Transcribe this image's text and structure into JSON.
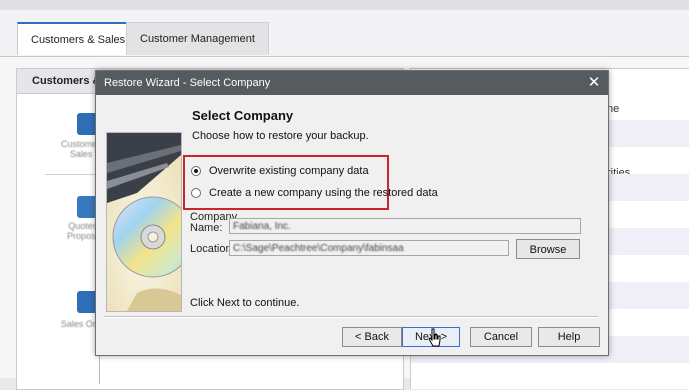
{
  "app": {
    "tabs": [
      {
        "label": "Customers & Sales"
      },
      {
        "label": "Customer Management"
      }
    ],
    "left_panel_title": "Customers & S",
    "workflow_labels": [
      "Customers & Sales Ta",
      "Quotes & Proposals",
      "Sales Orders"
    ],
    "right_panel_texts": [
      "ne",
      "rities"
    ]
  },
  "dialog": {
    "title": "Restore Wizard - Select Company",
    "close_label": "✕",
    "heading": "Select Company",
    "subheading": "Choose how to restore your backup.",
    "options": [
      {
        "label": "Overwrite existing company data",
        "selected": true
      },
      {
        "label": "Create a new company using the restored data",
        "selected": false
      }
    ],
    "company_name_label_line1": "Company",
    "company_name_label_line2": "Name:",
    "company_name_value": "Fabiana, Inc.",
    "location_label": "Location:",
    "location_value": "C:\\Sage\\Peachtree\\Company\\fabinsaa",
    "browse_label": "Browse",
    "hint": "Click Next to continue.",
    "buttons": {
      "back": "< Back",
      "next": "Next >",
      "cancel": "Cancel",
      "help": "Help"
    }
  },
  "colors": {
    "highlight_box": "#c7262c",
    "titlebar": "#555b5f",
    "active_tab_accent": "#2d6ebf"
  },
  "icons": [
    "close-icon",
    "cd-disc-image",
    "mouse-pointer-icon",
    "customer-icon",
    "quote-icon",
    "sales-order-icon"
  ]
}
